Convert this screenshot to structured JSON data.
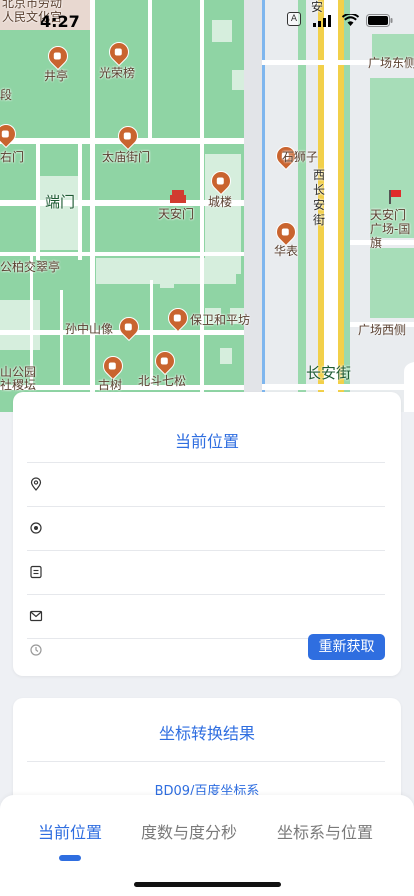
{
  "status_bar": {
    "time": "4:27",
    "location_glyph": "A"
  },
  "map": {
    "labels": {
      "p_renmin": "人民文化宫",
      "p_beijing": "北京市劳动",
      "p_jingting": "井亭",
      "p_guangrong": "光荣榜",
      "p_duan": "段",
      "p_youmen": "右门",
      "p_taimiao": "太庙街门",
      "p_shishizi": "石狮子",
      "p_duanmen": "端门",
      "p_chenglou": "城楼",
      "p_tiananmen": "天安门",
      "p_xichanganjie_v": "西长安街",
      "p_anv": "安",
      "p_guangchangdong": "广场东侧",
      "p_tiananmenguangchang": "天安门广场-国旗",
      "p_huabiao": "华表",
      "p_gongbai": "公柏交翠亭",
      "p_sunzhongshan": "孙中山像",
      "p_baowei": "保卫和平坊",
      "p_guangchangxi": "广场西侧",
      "p_shan": "山公园",
      "p_sheji": "社稷坛",
      "p_gushu": "古树",
      "p_beidou": "北斗七松",
      "p_changanjie": "长安街"
    }
  },
  "location_card": {
    "title": "当前位置",
    "rows": [
      {
        "icon": "location-pin-icon",
        "value": ""
      },
      {
        "icon": "target-icon",
        "value": ""
      },
      {
        "icon": "document-icon",
        "value": ""
      },
      {
        "icon": "mail-icon",
        "value": ""
      },
      {
        "icon": "clock-icon",
        "value": ""
      }
    ],
    "refetch_label": "重新获取"
  },
  "convert_card": {
    "title": "坐标转换结果",
    "subtitle": "BD09/百度坐标系"
  },
  "tabbar": {
    "tabs": [
      "当前位置",
      "度数与度分秒",
      "坐标系与位置"
    ],
    "active_index": 0
  },
  "colors": {
    "accent": "#2f6ee0",
    "park_green": "#8fd4a4",
    "road_yellow": "#f2d04a",
    "pin_brown": "#c9642f"
  }
}
